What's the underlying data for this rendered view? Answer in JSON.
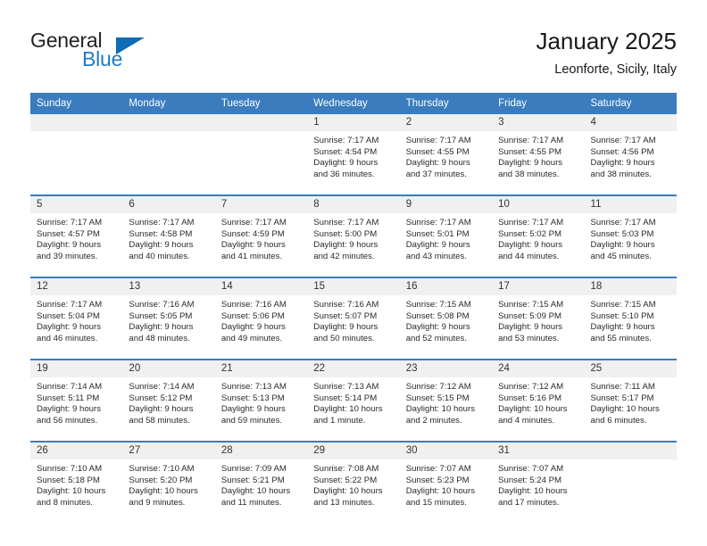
{
  "brand": {
    "word_one": "General",
    "word_two": "Blue",
    "triangle_color": "#0f6cb5",
    "blue_text_color": "#1f7ac4"
  },
  "header": {
    "title": "January 2025",
    "subtitle": "Leonforte, Sicily, Italy"
  },
  "theme": {
    "header_blue": "#3a7cbe",
    "daynum_bg": "#f0f0f0",
    "page_bg": "#ffffff"
  },
  "weekdays": [
    "Sunday",
    "Monday",
    "Tuesday",
    "Wednesday",
    "Thursday",
    "Friday",
    "Saturday"
  ],
  "labels": {
    "sunrise": "Sunrise:",
    "sunset": "Sunset:",
    "daylight": "Daylight:"
  },
  "weeks": [
    [
      {
        "empty": true
      },
      {
        "empty": true
      },
      {
        "empty": true
      },
      {
        "day": "1",
        "sunrise": "Sunrise: 7:17 AM",
        "sunset": "Sunset: 4:54 PM",
        "daylight1": "Daylight: 9 hours",
        "daylight2": "and 36 minutes."
      },
      {
        "day": "2",
        "sunrise": "Sunrise: 7:17 AM",
        "sunset": "Sunset: 4:55 PM",
        "daylight1": "Daylight: 9 hours",
        "daylight2": "and 37 minutes."
      },
      {
        "day": "3",
        "sunrise": "Sunrise: 7:17 AM",
        "sunset": "Sunset: 4:55 PM",
        "daylight1": "Daylight: 9 hours",
        "daylight2": "and 38 minutes."
      },
      {
        "day": "4",
        "sunrise": "Sunrise: 7:17 AM",
        "sunset": "Sunset: 4:56 PM",
        "daylight1": "Daylight: 9 hours",
        "daylight2": "and 38 minutes."
      }
    ],
    [
      {
        "day": "5",
        "sunrise": "Sunrise: 7:17 AM",
        "sunset": "Sunset: 4:57 PM",
        "daylight1": "Daylight: 9 hours",
        "daylight2": "and 39 minutes."
      },
      {
        "day": "6",
        "sunrise": "Sunrise: 7:17 AM",
        "sunset": "Sunset: 4:58 PM",
        "daylight1": "Daylight: 9 hours",
        "daylight2": "and 40 minutes."
      },
      {
        "day": "7",
        "sunrise": "Sunrise: 7:17 AM",
        "sunset": "Sunset: 4:59 PM",
        "daylight1": "Daylight: 9 hours",
        "daylight2": "and 41 minutes."
      },
      {
        "day": "8",
        "sunrise": "Sunrise: 7:17 AM",
        "sunset": "Sunset: 5:00 PM",
        "daylight1": "Daylight: 9 hours",
        "daylight2": "and 42 minutes."
      },
      {
        "day": "9",
        "sunrise": "Sunrise: 7:17 AM",
        "sunset": "Sunset: 5:01 PM",
        "daylight1": "Daylight: 9 hours",
        "daylight2": "and 43 minutes."
      },
      {
        "day": "10",
        "sunrise": "Sunrise: 7:17 AM",
        "sunset": "Sunset: 5:02 PM",
        "daylight1": "Daylight: 9 hours",
        "daylight2": "and 44 minutes."
      },
      {
        "day": "11",
        "sunrise": "Sunrise: 7:17 AM",
        "sunset": "Sunset: 5:03 PM",
        "daylight1": "Daylight: 9 hours",
        "daylight2": "and 45 minutes."
      }
    ],
    [
      {
        "day": "12",
        "sunrise": "Sunrise: 7:17 AM",
        "sunset": "Sunset: 5:04 PM",
        "daylight1": "Daylight: 9 hours",
        "daylight2": "and 46 minutes."
      },
      {
        "day": "13",
        "sunrise": "Sunrise: 7:16 AM",
        "sunset": "Sunset: 5:05 PM",
        "daylight1": "Daylight: 9 hours",
        "daylight2": "and 48 minutes."
      },
      {
        "day": "14",
        "sunrise": "Sunrise: 7:16 AM",
        "sunset": "Sunset: 5:06 PM",
        "daylight1": "Daylight: 9 hours",
        "daylight2": "and 49 minutes."
      },
      {
        "day": "15",
        "sunrise": "Sunrise: 7:16 AM",
        "sunset": "Sunset: 5:07 PM",
        "daylight1": "Daylight: 9 hours",
        "daylight2": "and 50 minutes."
      },
      {
        "day": "16",
        "sunrise": "Sunrise: 7:15 AM",
        "sunset": "Sunset: 5:08 PM",
        "daylight1": "Daylight: 9 hours",
        "daylight2": "and 52 minutes."
      },
      {
        "day": "17",
        "sunrise": "Sunrise: 7:15 AM",
        "sunset": "Sunset: 5:09 PM",
        "daylight1": "Daylight: 9 hours",
        "daylight2": "and 53 minutes."
      },
      {
        "day": "18",
        "sunrise": "Sunrise: 7:15 AM",
        "sunset": "Sunset: 5:10 PM",
        "daylight1": "Daylight: 9 hours",
        "daylight2": "and 55 minutes."
      }
    ],
    [
      {
        "day": "19",
        "sunrise": "Sunrise: 7:14 AM",
        "sunset": "Sunset: 5:11 PM",
        "daylight1": "Daylight: 9 hours",
        "daylight2": "and 56 minutes."
      },
      {
        "day": "20",
        "sunrise": "Sunrise: 7:14 AM",
        "sunset": "Sunset: 5:12 PM",
        "daylight1": "Daylight: 9 hours",
        "daylight2": "and 58 minutes."
      },
      {
        "day": "21",
        "sunrise": "Sunrise: 7:13 AM",
        "sunset": "Sunset: 5:13 PM",
        "daylight1": "Daylight: 9 hours",
        "daylight2": "and 59 minutes."
      },
      {
        "day": "22",
        "sunrise": "Sunrise: 7:13 AM",
        "sunset": "Sunset: 5:14 PM",
        "daylight1": "Daylight: 10 hours",
        "daylight2": "and 1 minute."
      },
      {
        "day": "23",
        "sunrise": "Sunrise: 7:12 AM",
        "sunset": "Sunset: 5:15 PM",
        "daylight1": "Daylight: 10 hours",
        "daylight2": "and 2 minutes."
      },
      {
        "day": "24",
        "sunrise": "Sunrise: 7:12 AM",
        "sunset": "Sunset: 5:16 PM",
        "daylight1": "Daylight: 10 hours",
        "daylight2": "and 4 minutes."
      },
      {
        "day": "25",
        "sunrise": "Sunrise: 7:11 AM",
        "sunset": "Sunset: 5:17 PM",
        "daylight1": "Daylight: 10 hours",
        "daylight2": "and 6 minutes."
      }
    ],
    [
      {
        "day": "26",
        "sunrise": "Sunrise: 7:10 AM",
        "sunset": "Sunset: 5:18 PM",
        "daylight1": "Daylight: 10 hours",
        "daylight2": "and 8 minutes."
      },
      {
        "day": "27",
        "sunrise": "Sunrise: 7:10 AM",
        "sunset": "Sunset: 5:20 PM",
        "daylight1": "Daylight: 10 hours",
        "daylight2": "and 9 minutes."
      },
      {
        "day": "28",
        "sunrise": "Sunrise: 7:09 AM",
        "sunset": "Sunset: 5:21 PM",
        "daylight1": "Daylight: 10 hours",
        "daylight2": "and 11 minutes."
      },
      {
        "day": "29",
        "sunrise": "Sunrise: 7:08 AM",
        "sunset": "Sunset: 5:22 PM",
        "daylight1": "Daylight: 10 hours",
        "daylight2": "and 13 minutes."
      },
      {
        "day": "30",
        "sunrise": "Sunrise: 7:07 AM",
        "sunset": "Sunset: 5:23 PM",
        "daylight1": "Daylight: 10 hours",
        "daylight2": "and 15 minutes."
      },
      {
        "day": "31",
        "sunrise": "Sunrise: 7:07 AM",
        "sunset": "Sunset: 5:24 PM",
        "daylight1": "Daylight: 10 hours",
        "daylight2": "and 17 minutes."
      },
      {
        "empty": true
      }
    ]
  ]
}
